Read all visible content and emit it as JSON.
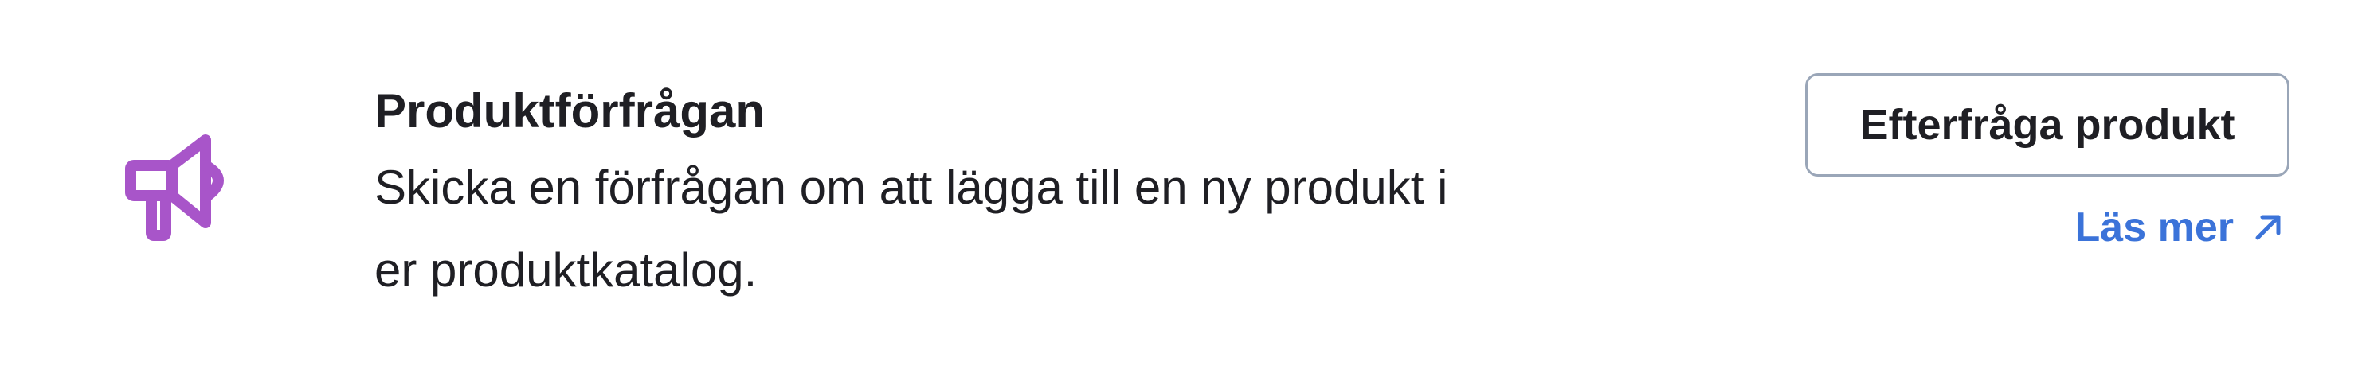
{
  "card": {
    "icon": "megaphone-icon",
    "accent_color": "#a855c9",
    "title": "Produktförfrågan",
    "description": "Skicka en förfrågan om att lägga till en ny produkt i er produktkatalog."
  },
  "actions": {
    "primary_label": "Efterfråga produkt",
    "link_label": "Läs mer",
    "link_icon": "external-arrow-icon",
    "link_color": "#3b73d9"
  }
}
